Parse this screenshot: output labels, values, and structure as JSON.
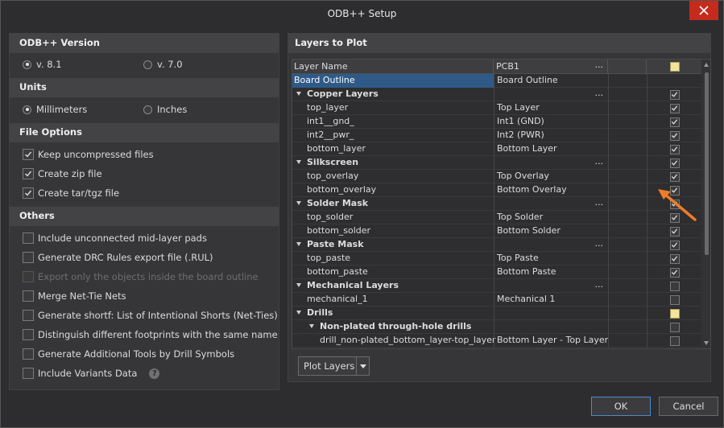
{
  "window": {
    "title": "ODB++ Setup"
  },
  "left": {
    "version": {
      "heading": "ODB++ Version",
      "options": [
        {
          "label": "v. 8.1",
          "selected": true
        },
        {
          "label": "v. 7.0",
          "selected": false
        }
      ]
    },
    "units": {
      "heading": "Units",
      "options": [
        {
          "label": "Millimeters",
          "selected": true
        },
        {
          "label": "Inches",
          "selected": false
        }
      ]
    },
    "file_options": {
      "heading": "File Options",
      "items": [
        {
          "label": "Keep uncompressed files",
          "checked": true
        },
        {
          "label": "Create zip file",
          "checked": true
        },
        {
          "label": "Create tar/tgz file",
          "checked": true
        }
      ]
    },
    "others": {
      "heading": "Others",
      "items": [
        {
          "label": "Include unconnected mid-layer pads",
          "checked": false,
          "disabled": false
        },
        {
          "label": "Generate DRC Rules export file (.RUL)",
          "checked": false,
          "disabled": false
        },
        {
          "label": "Export only the objects inside the board outline",
          "checked": false,
          "disabled": true
        },
        {
          "label": "Merge Net-Tie Nets",
          "checked": false,
          "disabled": false
        },
        {
          "label": "Generate shortf: List of Intentional Shorts (Net-Ties)",
          "checked": false,
          "disabled": false
        },
        {
          "label": "Distinguish different footprints with the same name",
          "checked": false,
          "disabled": false
        },
        {
          "label": "Generate Additional Tools by Drill Symbols",
          "checked": false,
          "disabled": false
        },
        {
          "label": "Include Variants Data",
          "checked": false,
          "disabled": false
        }
      ],
      "help": "?"
    }
  },
  "layers": {
    "heading": "Layers to Plot",
    "columns": {
      "name": "Layer Name",
      "pcb": "PCB1",
      "dots": "..."
    },
    "rows": [
      {
        "name": "Board Outline",
        "pcb": "Board Outline",
        "level": 0,
        "group": false,
        "selected": true,
        "state": "none",
        "dots": false
      },
      {
        "name": "Copper Layers",
        "pcb": "",
        "level": 0,
        "group": true,
        "state": "checked",
        "dots": true
      },
      {
        "name": "top_layer",
        "pcb": "Top Layer",
        "level": 1,
        "group": false,
        "state": "checked",
        "dots": false
      },
      {
        "name": "int1__gnd_",
        "pcb": "Int1 (GND)",
        "level": 1,
        "group": false,
        "state": "checked",
        "dots": false
      },
      {
        "name": "int2__pwr_",
        "pcb": "Int2 (PWR)",
        "level": 1,
        "group": false,
        "state": "checked",
        "dots": false
      },
      {
        "name": "bottom_layer",
        "pcb": "Bottom Layer",
        "level": 1,
        "group": false,
        "state": "checked",
        "dots": false
      },
      {
        "name": "Silkscreen",
        "pcb": "",
        "level": 0,
        "group": true,
        "state": "checked",
        "dots": true
      },
      {
        "name": "top_overlay",
        "pcb": "Top Overlay",
        "level": 1,
        "group": false,
        "state": "checked",
        "dots": false
      },
      {
        "name": "bottom_overlay",
        "pcb": "Bottom Overlay",
        "level": 1,
        "group": false,
        "state": "checked",
        "dots": false
      },
      {
        "name": "Solder Mask",
        "pcb": "",
        "level": 0,
        "group": true,
        "state": "checked",
        "dots": true
      },
      {
        "name": "top_solder",
        "pcb": "Top Solder",
        "level": 1,
        "group": false,
        "state": "checked",
        "dots": false
      },
      {
        "name": "bottom_solder",
        "pcb": "Bottom Solder",
        "level": 1,
        "group": false,
        "state": "checked",
        "dots": false
      },
      {
        "name": "Paste Mask",
        "pcb": "",
        "level": 0,
        "group": true,
        "state": "checked",
        "dots": true
      },
      {
        "name": "top_paste",
        "pcb": "Top Paste",
        "level": 1,
        "group": false,
        "state": "checked",
        "dots": false
      },
      {
        "name": "bottom_paste",
        "pcb": "Bottom Paste",
        "level": 1,
        "group": false,
        "state": "checked",
        "dots": false
      },
      {
        "name": "Mechanical Layers",
        "pcb": "",
        "level": 0,
        "group": true,
        "state": "unchecked",
        "dots": true
      },
      {
        "name": "mechanical_1",
        "pcb": "Mechanical 1",
        "level": 1,
        "group": false,
        "state": "unchecked",
        "dots": false
      },
      {
        "name": "Drills",
        "pcb": "",
        "level": 0,
        "group": true,
        "state": "partial",
        "dots": false
      },
      {
        "name": "Non-plated through-hole drills",
        "pcb": "",
        "level": 1,
        "group": true,
        "state": "unchecked",
        "dots": false
      },
      {
        "name": "drill_non-plated_bottom_layer-top_layer",
        "pcb": "Bottom Layer - Top Layer",
        "level": 2,
        "group": false,
        "state": "unchecked",
        "dots": false
      }
    ],
    "plot_button": "Plot Layers"
  },
  "footer": {
    "ok": "OK",
    "cancel": "Cancel"
  },
  "colors": {
    "accent": "#f07c28",
    "selection": "#2f5a88",
    "close": "#c42b1c"
  }
}
